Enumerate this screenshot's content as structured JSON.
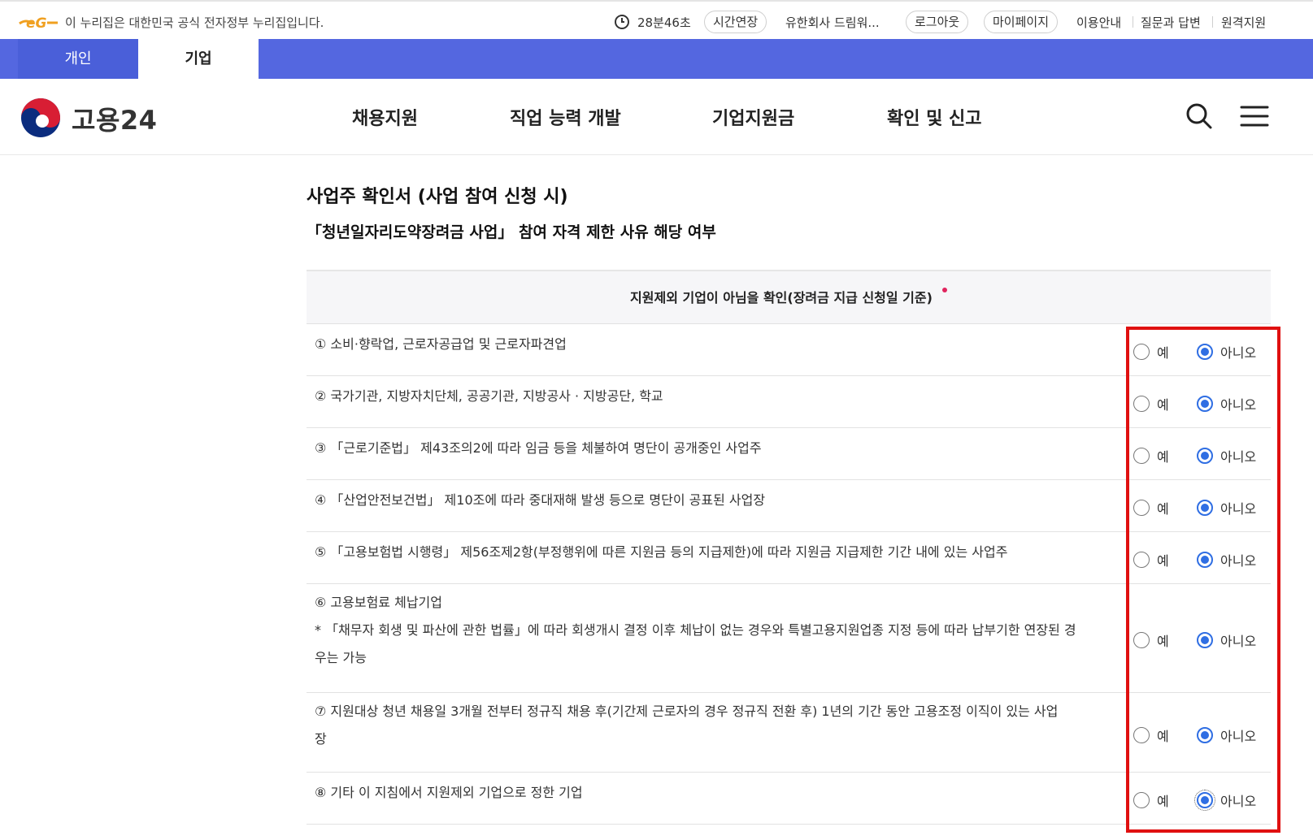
{
  "topbar": {
    "gov_notice": "이 누리집은 대한민국 공식 전자정부 누리집입니다.",
    "timer": "28분46초",
    "extend_label": "시간연장",
    "company_name": "유한회사 드림워...",
    "logout_label": "로그아웃",
    "mypage_label": "마이페이지",
    "links": [
      "이용안내",
      "질문과 답변",
      "원격지원"
    ]
  },
  "tabs": {
    "personal": "개인",
    "business": "기업",
    "active": "기업"
  },
  "header": {
    "logo_text": "고용24",
    "nav": [
      "채용지원",
      "직업 능력 개발",
      "기업지원금",
      "확인 및 신고"
    ]
  },
  "content": {
    "title": "사업주 확인서 (사업 참여 신청 시)",
    "subtitle": "「청년일자리도약장려금 사업」 참여 자격 제한 사유 해당 여부",
    "table_header": "지원제외 기업이 아님을 확인(장려금 지급 신청일 기준)",
    "yes_label": "예",
    "no_label": "아니오",
    "rows": [
      {
        "lines": [
          "① 소비·향락업, 근로자공급업 및 근로자파견업"
        ],
        "selected": "아니오"
      },
      {
        "lines": [
          "② 국가기관, 지방자치단체, 공공기관, 지방공사 · 지방공단, 학교"
        ],
        "selected": "아니오"
      },
      {
        "lines": [
          "③ 「근로기준법」 제43조의2에 따라 임금 등을 체불하여 명단이 공개중인 사업주"
        ],
        "selected": "아니오"
      },
      {
        "lines": [
          "④ 「산업안전보건법」 제10조에 따라 중대재해 발생 등으로 명단이 공표된 사업장"
        ],
        "selected": "아니오"
      },
      {
        "lines": [
          "⑤ 「고용보험법 시행령」 제56조제2항(부정행위에 따른 지원금 등의 지급제한)에 따라 지원금 지급제한 기간 내에 있는 사업주"
        ],
        "selected": "아니오"
      },
      {
        "lines": [
          "⑥ 고용보험료 체납기업",
          "* 「채무자 회생 및 파산에 관한 법률」에 따라 회생개시 결정 이후 체납이 없는 경우와 특별고용지원업종 지정 등에 따라 납부기한 연장된 경",
          "우는 가능"
        ],
        "selected": "아니오"
      },
      {
        "lines": [
          "⑦ 지원대상 청년 채용일 3개월 전부터 정규직 채용 후(기간제 근로자의 경우 정규직 전환 후) 1년의 기간 동안 고용조정 이직이 있는 사업",
          "장"
        ],
        "selected": "아니오"
      },
      {
        "lines": [
          "⑧ 기타 이 지침에서 지원제외 기업으로 정한 기업"
        ],
        "selected": "아니오"
      }
    ]
  }
}
